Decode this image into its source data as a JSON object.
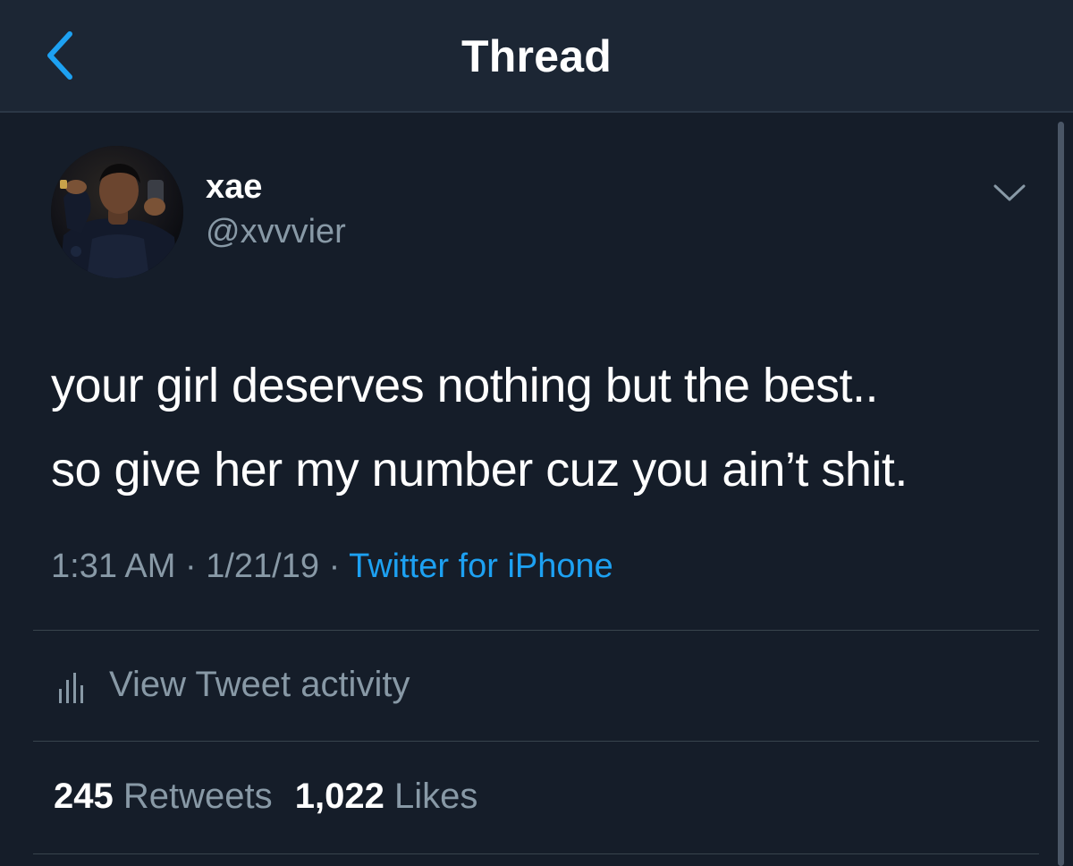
{
  "nav": {
    "title": "Thread",
    "back_icon": "chevron-left-icon"
  },
  "tweet": {
    "display_name": "xae",
    "handle": "@xvvvier",
    "text_lines": [
      "your girl deserves nothing but the best..",
      "so give her my number cuz you ain’t shit."
    ],
    "time": "1:31 AM",
    "separator": "·",
    "date": "1/21/19",
    "source": "Twitter for iPhone",
    "menu_icon": "chevron-down-icon"
  },
  "activity": {
    "label": "View Tweet activity",
    "icon": "bar-chart-icon"
  },
  "stats": {
    "retweets_count": "245",
    "retweets_label": "Retweets",
    "likes_count": "1,022",
    "likes_label": "Likes"
  },
  "colors": {
    "background": "#151d29",
    "nav_background": "#1c2634",
    "accent": "#1da1f2",
    "secondary_text": "#8899a6",
    "divider": "#38444d"
  }
}
